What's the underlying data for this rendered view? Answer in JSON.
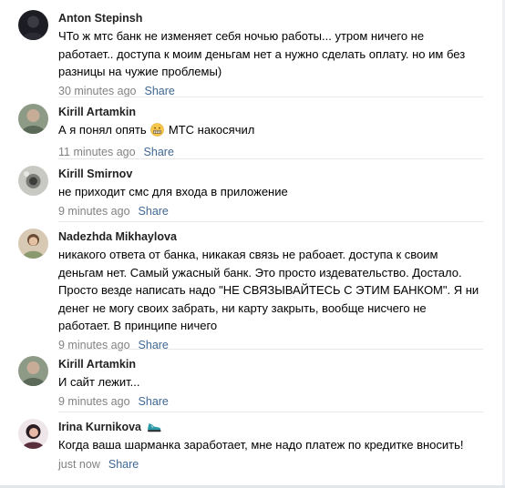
{
  "comments": [
    {
      "author": "Anton Stepinsh",
      "lines": [
        "ЧТо ж мтс банк не изменяет себя ночью работы... утром ничего не",
        "работает.. доступа к моим деньгам нет а нужно сделать оплату. но им без",
        "разницы на чужие проблемы)"
      ],
      "time": "30 minutes ago",
      "share": "Share"
    },
    {
      "author": "Kirill Artamkin",
      "text_before_emoji": "А я понял опять",
      "emoji": "grimacing-face-emoji",
      "text_after_emoji": "МТС накосячил",
      "time": "11 minutes ago",
      "share": "Share"
    },
    {
      "author": "Kirill Smirnov",
      "lines": [
        "не приходит смс для входа в приложение"
      ],
      "time": "9 minutes ago",
      "share": "Share"
    },
    {
      "author": "Nadezhda Mikhaylova",
      "lines": [
        "никакого ответа от банка, никакая связь не рабоает. доступа к своим",
        "деньгам нет. Самый ужасный банк. Это просто издевательство. Достало.",
        "Просто везде написать надо \"НЕ СВЯЗЫВАЙТЕСЬ С ЭТИМ БАНКОМ\". Я ни",
        "денег не могу своих забрать, ни карту закрыть, вообще нисчего не",
        "работает. В принципе ничего"
      ],
      "time": "9 minutes ago",
      "share": "Share"
    },
    {
      "author": "Kirill Artamkin",
      "lines": [
        "И сайт лежит..."
      ],
      "time": "9 minutes ago",
      "share": "Share"
    },
    {
      "author": "Irina Kurnikova",
      "author_badge": "sneaker-icon",
      "lines": [
        "Когда ваша шарманка заработает, мне надо платеж по кредитке вносить!"
      ],
      "time": "just now",
      "share": "Share"
    }
  ],
  "colors": {
    "author": "#222222",
    "text": "#000000",
    "meta": "#828282",
    "share_link": "#3f6894",
    "divider": "#e7e8ec"
  }
}
